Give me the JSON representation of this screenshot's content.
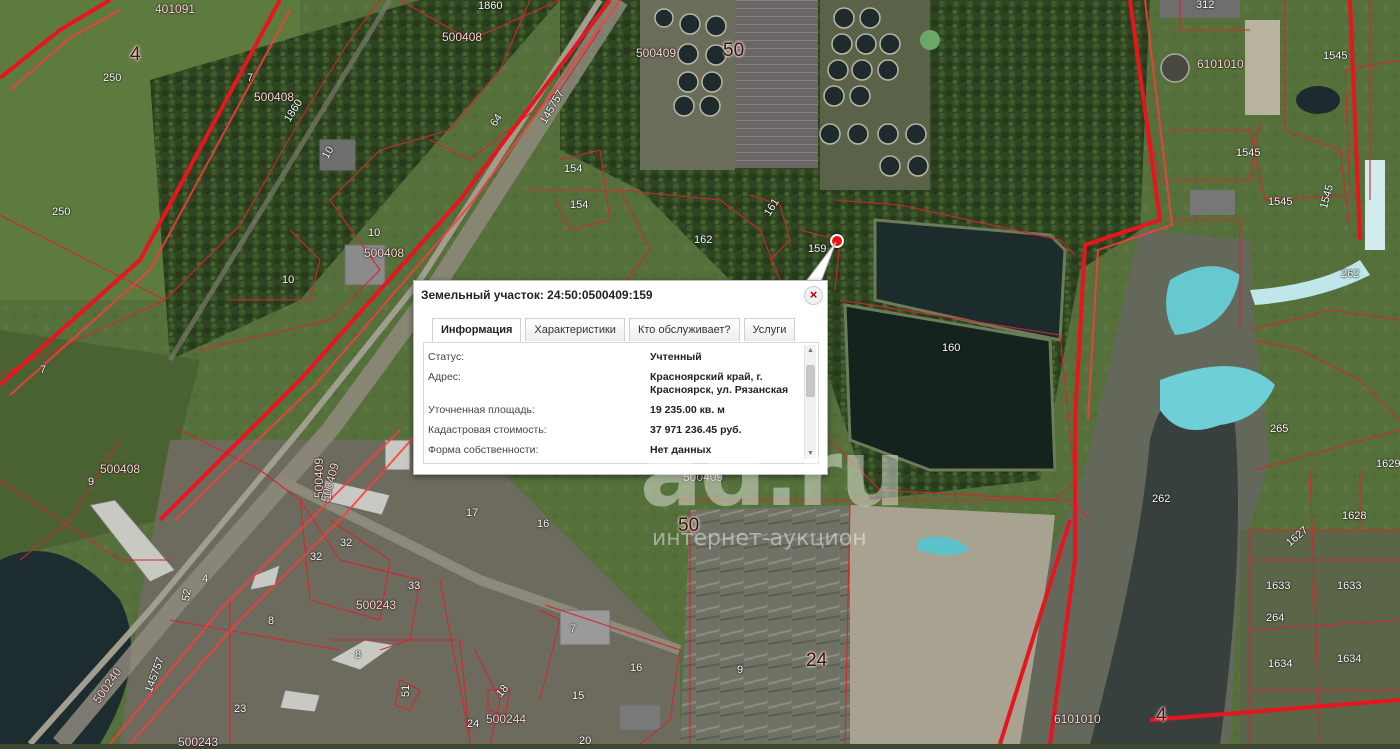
{
  "map": {
    "plot_labels": [
      {
        "id": "l1",
        "text": "401091"
      },
      {
        "id": "l2",
        "text": "4"
      },
      {
        "id": "l3",
        "text": "250"
      },
      {
        "id": "l4",
        "text": "7"
      },
      {
        "id": "l5",
        "text": "500408"
      },
      {
        "id": "l6",
        "text": "1860"
      },
      {
        "id": "l7",
        "text": "500408"
      },
      {
        "id": "l8",
        "text": "250"
      },
      {
        "id": "l9",
        "text": "1860"
      },
      {
        "id": "l10",
        "text": "10"
      },
      {
        "id": "l11",
        "text": "10"
      },
      {
        "id": "l12",
        "text": "500408"
      },
      {
        "id": "l13",
        "text": "10"
      },
      {
        "id": "l14",
        "text": "64"
      },
      {
        "id": "l15",
        "text": "145757"
      },
      {
        "id": "l16",
        "text": "154"
      },
      {
        "id": "l17",
        "text": "154"
      },
      {
        "id": "l18",
        "text": "500409"
      },
      {
        "id": "l19",
        "text": "50"
      },
      {
        "id": "l20",
        "text": "161"
      },
      {
        "id": "l21",
        "text": "162"
      },
      {
        "id": "l22",
        "text": "159"
      },
      {
        "id": "l23",
        "text": "160"
      },
      {
        "id": "l24",
        "text": "7"
      },
      {
        "id": "l25",
        "text": "500408"
      },
      {
        "id": "l26",
        "text": "9"
      },
      {
        "id": "l27",
        "text": "500409"
      },
      {
        "id": "l28",
        "text": "10"
      },
      {
        "id": "l29",
        "text": "17"
      },
      {
        "id": "l30",
        "text": "16"
      },
      {
        "id": "l31",
        "text": "500409"
      },
      {
        "id": "l32",
        "text": "50"
      },
      {
        "id": "l33",
        "text": "32"
      },
      {
        "id": "l34",
        "text": "32"
      },
      {
        "id": "l35",
        "text": "33"
      },
      {
        "id": "l36",
        "text": "500243"
      },
      {
        "id": "l37",
        "text": "8"
      },
      {
        "id": "l38",
        "text": "8"
      },
      {
        "id": "l39",
        "text": "4"
      },
      {
        "id": "l40",
        "text": "52"
      },
      {
        "id": "l41",
        "text": "500240"
      },
      {
        "id": "l42",
        "text": "145757"
      },
      {
        "id": "l43",
        "text": "23"
      },
      {
        "id": "l44",
        "text": "500243"
      },
      {
        "id": "l45",
        "text": "7"
      },
      {
        "id": "l46",
        "text": "16"
      },
      {
        "id": "l47",
        "text": "15"
      },
      {
        "id": "l48",
        "text": "18"
      },
      {
        "id": "l49",
        "text": "500244"
      },
      {
        "id": "l50",
        "text": "20"
      },
      {
        "id": "l51",
        "text": "51"
      },
      {
        "id": "l52",
        "text": "24"
      },
      {
        "id": "l53",
        "text": "24"
      },
      {
        "id": "l54",
        "text": "9"
      },
      {
        "id": "l55",
        "text": "312"
      },
      {
        "id": "l56",
        "text": "6101010"
      },
      {
        "id": "l57",
        "text": "1545"
      },
      {
        "id": "l58",
        "text": "1545"
      },
      {
        "id": "l59",
        "text": "1545"
      },
      {
        "id": "l60",
        "text": "1545"
      },
      {
        "id": "l61",
        "text": "262"
      },
      {
        "id": "l62",
        "text": "265"
      },
      {
        "id": "l63",
        "text": "262"
      },
      {
        "id": "l64",
        "text": "1629"
      },
      {
        "id": "l65",
        "text": "1628"
      },
      {
        "id": "l66",
        "text": "1627"
      },
      {
        "id": "l67",
        "text": "1633"
      },
      {
        "id": "l68",
        "text": "1633"
      },
      {
        "id": "l69",
        "text": "264"
      },
      {
        "id": "l70",
        "text": "1634"
      },
      {
        "id": "l71",
        "text": "1634"
      },
      {
        "id": "l72",
        "text": "6101010"
      },
      {
        "id": "l73",
        "text": "4"
      },
      {
        "id": "l74",
        "text": "500409"
      }
    ]
  },
  "popup": {
    "title": "Земельный участок: 24:50:0500409:159",
    "close_glyph": "×",
    "tabs": [
      "Информация",
      "Характеристики",
      "Кто обслуживает?",
      "Услуги"
    ],
    "rows": [
      {
        "key": "Статус:",
        "value": "Учтенный"
      },
      {
        "key": "Адрес:",
        "value": "Красноярский край, г. Красноярск, ул. Рязанская"
      },
      {
        "key": "Уточненная площадь:",
        "value": "19 235.00 кв. м"
      },
      {
        "key": "Кадастровая стоимость:",
        "value": "37 971 236.45 руб."
      },
      {
        "key": "Форма собственности:",
        "value": "Нет данных"
      }
    ]
  },
  "watermark": {
    "main": "ad.ru",
    "sub": "интернет-аукцион"
  },
  "colors": {
    "boundary": "#e8141e",
    "thin_boundary": "#d0272f",
    "water": "#1c2a2e",
    "lagoon": "#6ecfd6"
  }
}
